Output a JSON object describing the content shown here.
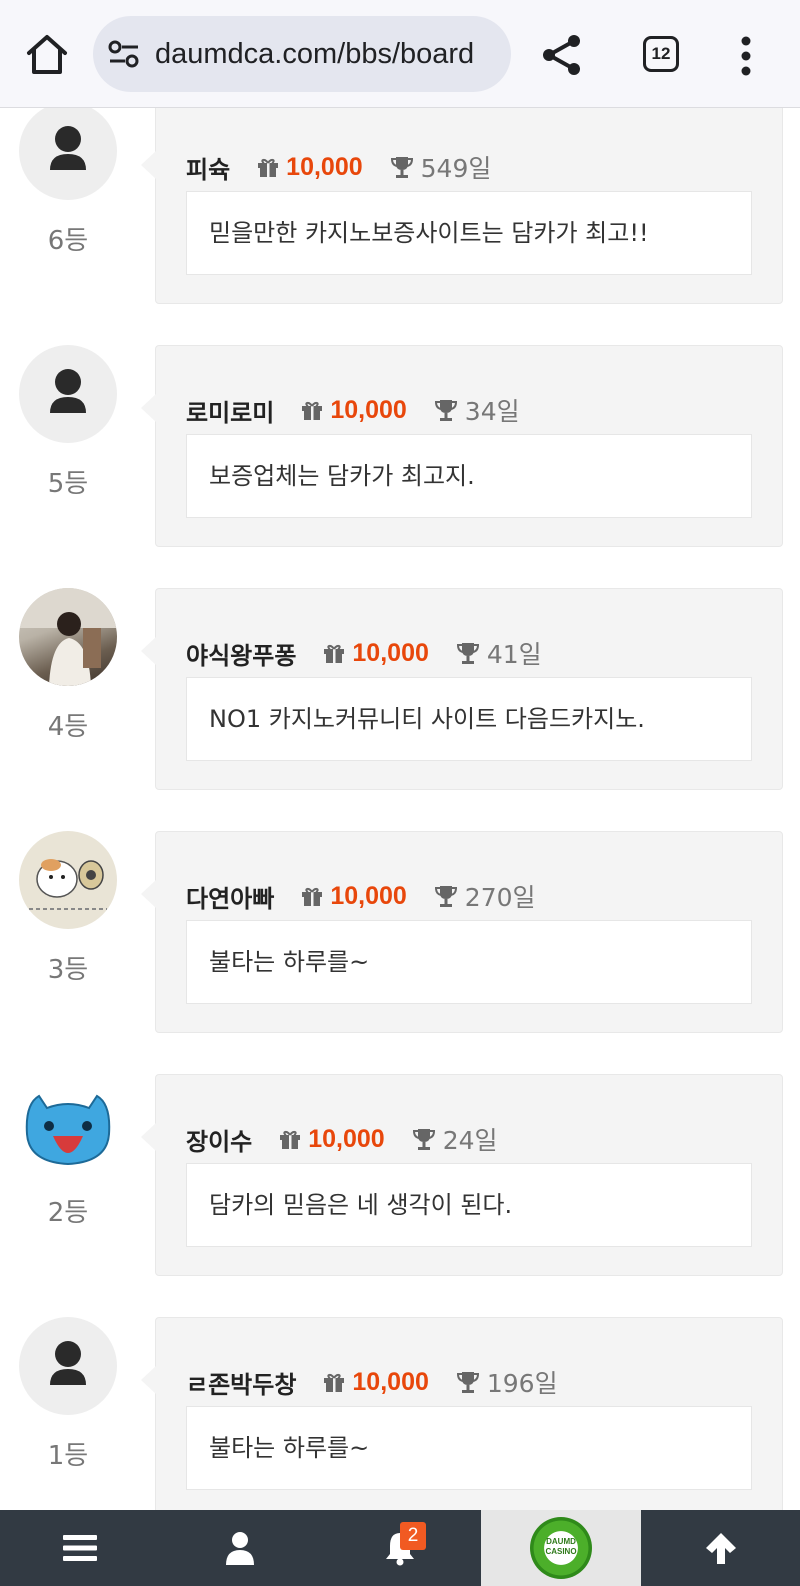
{
  "browser": {
    "url": "daumdca.com/bbs/board",
    "tab_count": "12"
  },
  "comments": [
    {
      "rank": "6등",
      "nick": "피슉",
      "points": "10,000",
      "days": "549일",
      "message": "믿을만한 카지노보증사이트는 담카가 최고!!",
      "avatar": "default-user"
    },
    {
      "rank": "5등",
      "nick": "로미로미",
      "points": "10,000",
      "days": "34일",
      "message": "보증업체는 담카가 최고지.",
      "avatar": "default-user"
    },
    {
      "rank": "4등",
      "nick": "야식왕푸퐁",
      "points": "10,000",
      "days": "41일",
      "message": "NO1 카지노커뮤니티 사이트 다음드카지노.",
      "avatar": "photo-person"
    },
    {
      "rank": "3등",
      "nick": "다연아빠",
      "points": "10,000",
      "days": "270일",
      "message": "불타는 하루를~",
      "avatar": "hamster-sketch"
    },
    {
      "rank": "2등",
      "nick": "장이수",
      "points": "10,000",
      "days": "24일",
      "message": "담카의 믿음은 네 생각이 된다.",
      "avatar": "blue-cat"
    },
    {
      "rank": "1등",
      "nick": "ㄹ존박두창",
      "points": "10,000",
      "days": "196일",
      "message": "불타는 하루를~",
      "avatar": "default-user"
    }
  ],
  "bottom_nav": {
    "notification_count": "2",
    "logo_text_line1": "DAUMD",
    "logo_text_line2": "CASINO"
  },
  "colors": {
    "points": "#e8470b",
    "nav_bg": "#323a43",
    "badge": "#f15a22"
  }
}
